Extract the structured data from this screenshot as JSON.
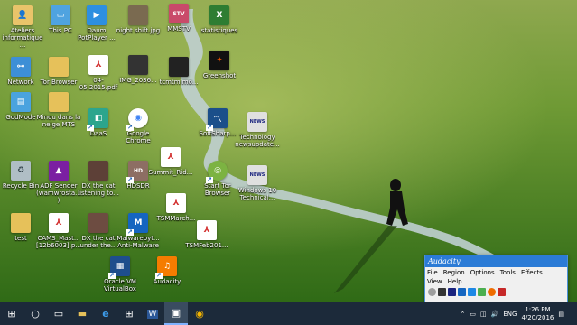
{
  "desktop": {
    "icons": [
      {
        "label": "Ateliers informatique ...",
        "icon": "folder-user-icon",
        "color": "#e9c46a"
      },
      {
        "label": "This PC",
        "icon": "computer-icon",
        "color": "#4fa3e0"
      },
      {
        "label": "Daum PotPlayer ...",
        "icon": "play-icon",
        "color": "#2d8fe0"
      },
      {
        "label": "night shift.jpg",
        "icon": "image-file-icon",
        "color": "#7a6a50"
      },
      {
        "label": "MMSTV",
        "icon": "mmstv-icon",
        "color": "#c94a6a"
      },
      {
        "label": "statistiques",
        "icon": "excel-icon",
        "color": "#2e7d32"
      },
      {
        "label": "Network",
        "icon": "network-icon",
        "color": "#3d8fd6"
      },
      {
        "label": "Tor Browser",
        "icon": "folder-icon",
        "color": "#e6c15a"
      },
      {
        "label": "04-05.2015.pdf",
        "icon": "pdf-icon",
        "color": "#d32f2f"
      },
      {
        "label": "IMG_2036...",
        "icon": "image-file-icon",
        "color": "#333333"
      },
      {
        "label": "tcmtm.mo...",
        "icon": "video-file-icon",
        "color": "#222222"
      },
      {
        "label": "Greenshot",
        "icon": "greenshot-icon",
        "color": "#e65100"
      },
      {
        "label": "GodMode",
        "icon": "control-panel-icon",
        "color": "#4aa3df"
      },
      {
        "label": "Minou dans la neige MTS",
        "icon": "folder-icon",
        "color": "#e6c15a"
      },
      {
        "label": "DaaS",
        "icon": "app-icon",
        "color": "#2ca58d"
      },
      {
        "label": "Google Chrome",
        "icon": "chrome-icon",
        "color": "#4285f4"
      },
      {
        "label": "SoftSharp...",
        "icon": "chart-app-icon",
        "color": "#1b4f8a"
      },
      {
        "label": "Technology newsupdate...",
        "icon": "tech-news-icon",
        "color": "#e0e0e0"
      },
      {
        "label": "Recycle Bin",
        "icon": "recycle-bin-icon",
        "color": "#b0bec5"
      },
      {
        "label": "ADF Sender (wamwrosta...)",
        "icon": "adf-icon",
        "color": "#7b1fa2"
      },
      {
        "label": "DX the cat listening to...",
        "icon": "video-file-icon",
        "color": "#5d4037"
      },
      {
        "label": "HDSDR",
        "icon": "hdsdr-icon",
        "color": "#8d6e63"
      },
      {
        "label": "Summit_Rid...",
        "icon": "pdf-icon",
        "color": "#d32f2f"
      },
      {
        "label": "Start Tor Browser",
        "icon": "tor-icon",
        "color": "#7cb342"
      },
      {
        "label": "Windows 10 Technical...",
        "icon": "tech-news-icon",
        "color": "#e0e0e0"
      },
      {
        "label": "test",
        "icon": "folder-icon",
        "color": "#e6c15a"
      },
      {
        "label": "CAMS_Mast... [12b6003].p...",
        "icon": "pdf-icon",
        "color": "#d32f2f"
      },
      {
        "label": "DX the cat under the...",
        "icon": "video-file-icon",
        "color": "#6d4c41"
      },
      {
        "label": "Malwarebyt... Anti-Malware",
        "icon": "malwarebytes-icon",
        "color": "#1565c0"
      },
      {
        "label": "TSMMarch...",
        "icon": "pdf-icon",
        "color": "#d32f2f"
      },
      {
        "label": "TSMFeb201...",
        "icon": "pdf-icon",
        "color": "#d32f2f"
      },
      {
        "label": "Oracle VM VirtualBox",
        "icon": "virtualbox-icon",
        "color": "#1e4e8c"
      },
      {
        "label": "Audacity",
        "icon": "audacity-icon",
        "color": "#f57c00"
      }
    ]
  },
  "audacity": {
    "title": "Audacity",
    "menu": [
      "File",
      "Region",
      "Options",
      "Tools",
      "Effects",
      "View",
      "Help"
    ],
    "tools": [
      {
        "icon": "record-icon",
        "color": "#9e9e9e"
      },
      {
        "icon": "waveform-icon",
        "color": "#333333"
      },
      {
        "icon": "track-icon",
        "color": "#1a237e"
      },
      {
        "icon": "selection-icon",
        "color": "#1565c0"
      },
      {
        "icon": "zoom-icon",
        "color": "#1e88e5"
      },
      {
        "icon": "effect-icon",
        "color": "#4caf50"
      },
      {
        "icon": "settings-icon",
        "color": "#ef6c00"
      },
      {
        "icon": "cursor-icon",
        "color": "#c62828"
      }
    ]
  },
  "taskbar": {
    "buttons": [
      {
        "name": "start",
        "glyph": "⊞"
      },
      {
        "name": "search",
        "glyph": "○"
      },
      {
        "name": "task-view",
        "glyph": "▭"
      },
      {
        "name": "file-explorer",
        "glyph": "▬"
      },
      {
        "name": "edge",
        "glyph": "e"
      },
      {
        "name": "store",
        "glyph": "⊞"
      },
      {
        "name": "word",
        "glyph": "W"
      },
      {
        "name": "audacity-active",
        "glyph": "▣"
      },
      {
        "name": "chrome",
        "glyph": "◉"
      }
    ],
    "tray": {
      "language": "ENG",
      "time": "1:26 PM",
      "date": "4/20/2016"
    }
  },
  "colors": {
    "sky_top": "#88a24d",
    "grass": "#3f7d1f",
    "path": "#b7c6c8",
    "taskbar": "#1c2a3a"
  }
}
